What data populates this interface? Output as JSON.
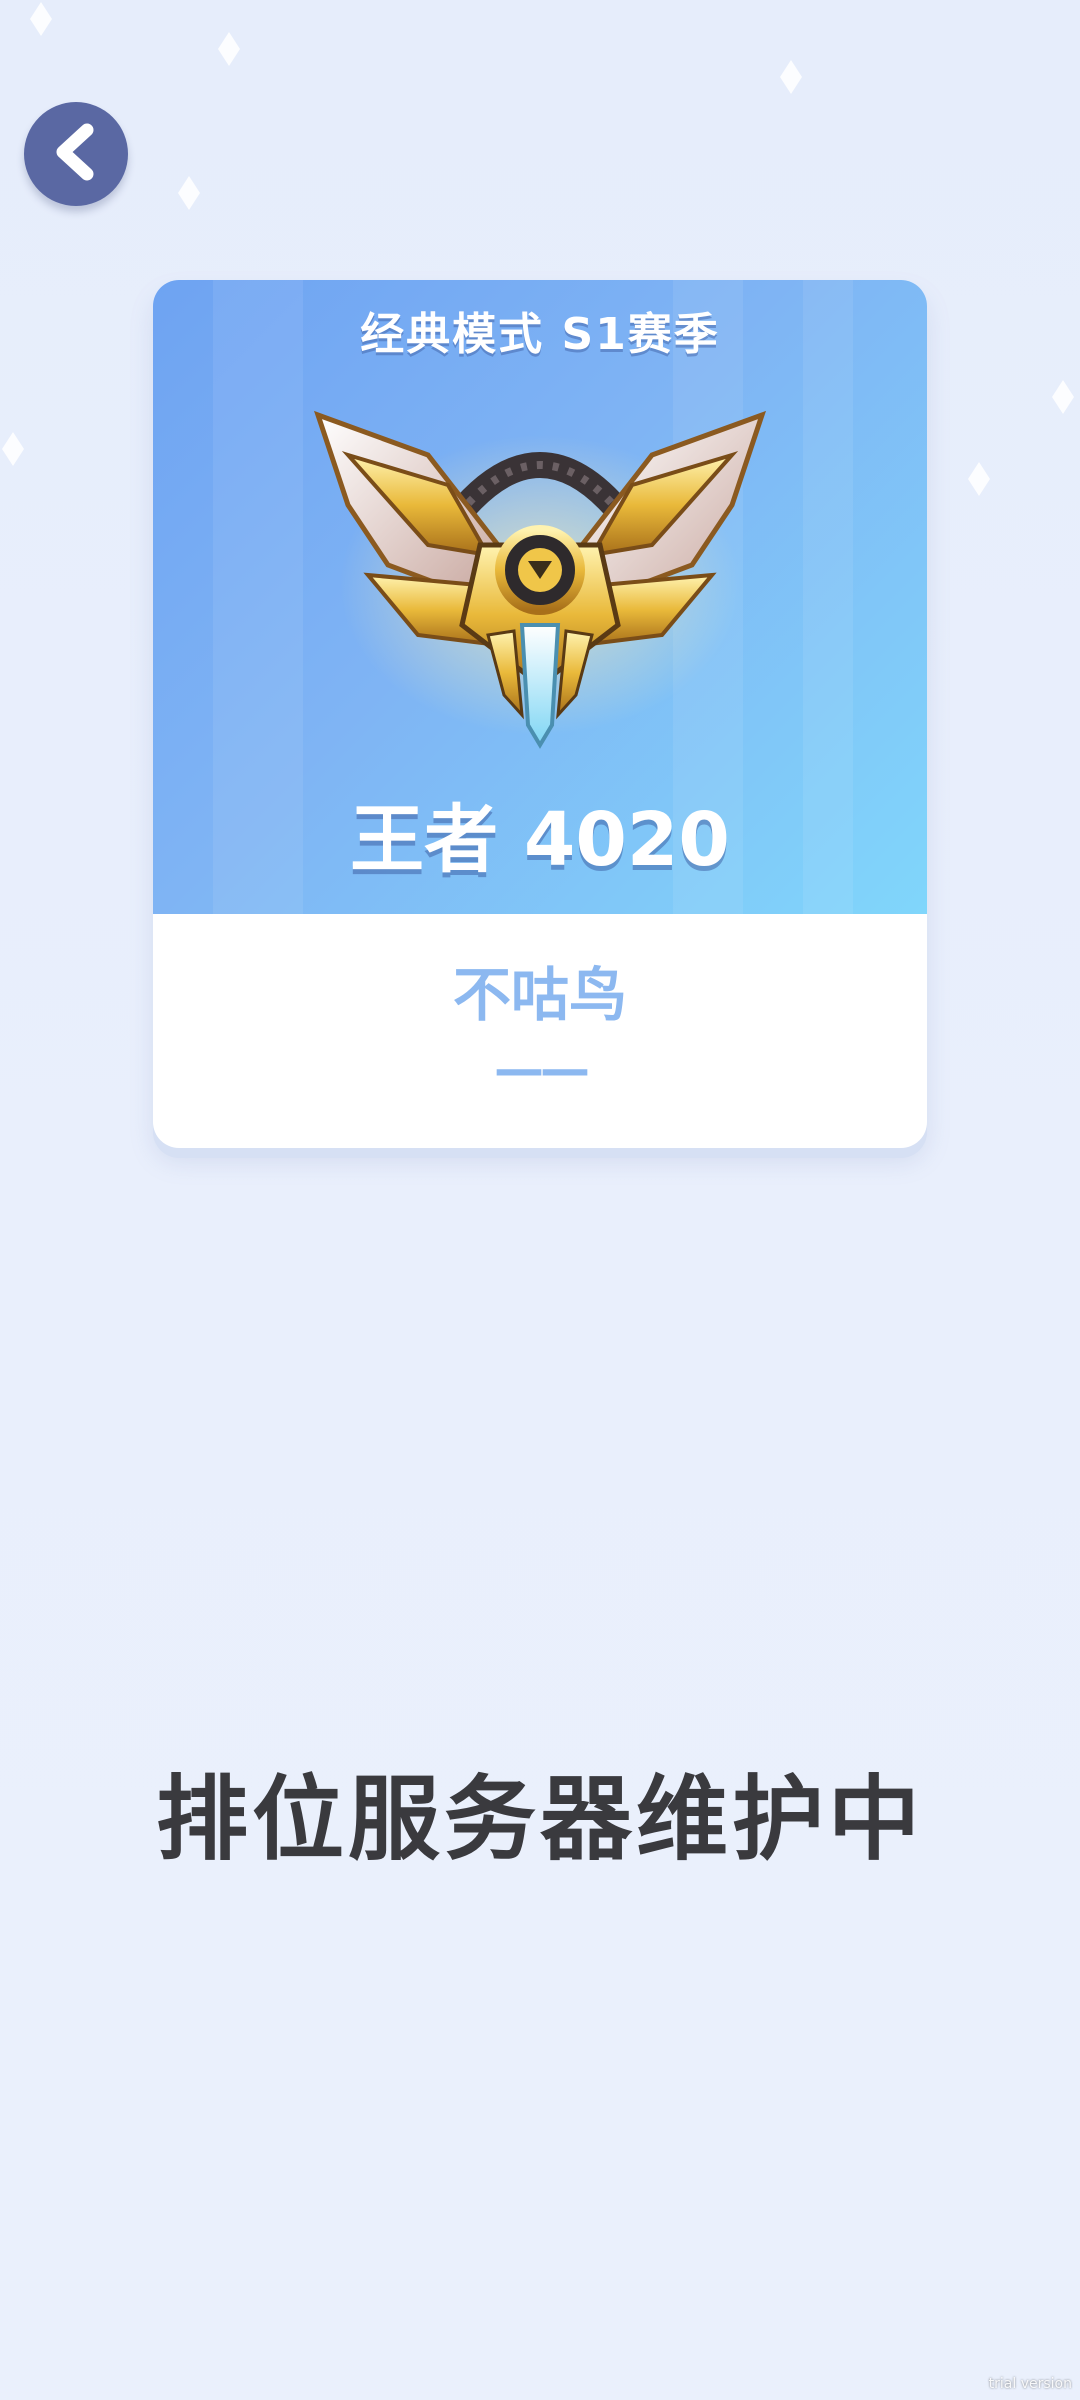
{
  "header": {
    "back_icon": "chevron-left-icon"
  },
  "rank_card": {
    "season_title": "经典模式 S1赛季",
    "rank_label": "王者 4020",
    "emblem_icon": "king-rank-emblem-icon",
    "player_name": "不咕鸟",
    "player_subtitle": "——"
  },
  "status": {
    "message": "排位服务器维护中"
  },
  "watermark": "trial version",
  "colors": {
    "card_gradient_start": "#6ea3f2",
    "card_gradient_end": "#80d6fb",
    "name_color": "#8cb8f0",
    "back_button": "#5a68a3",
    "message_color": "#3a3a3e"
  }
}
